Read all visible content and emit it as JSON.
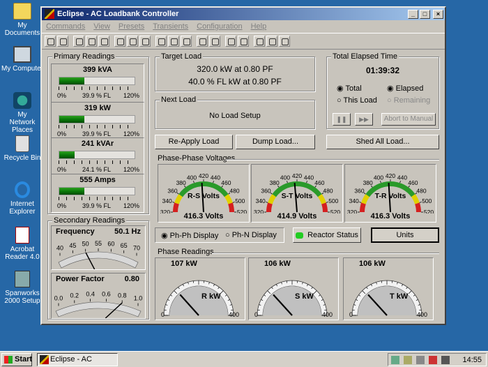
{
  "desktop": {
    "icons": [
      {
        "label": "My Documents"
      },
      {
        "label": "My Computer"
      },
      {
        "label": "My Network Places"
      },
      {
        "label": "Recycle Bin"
      },
      {
        "label": "Internet Explorer"
      },
      {
        "label": "Acrobat Reader 4.0"
      },
      {
        "label": "Spanworks 2000 Setup"
      }
    ]
  },
  "window": {
    "title": "Eclipse - AC Loadbank Controller",
    "controls": {
      "minimize": "_",
      "maximize": "□",
      "close": "×"
    }
  },
  "menu": [
    "Commands",
    "View",
    "Presets",
    "Transients",
    "Configuration",
    "Help"
  ],
  "primary": {
    "title": "Primary Readings",
    "readings": [
      {
        "value": "399 kVA",
        "pct": "39.9 % FL",
        "fill": 0.333,
        "lo": "0%",
        "hi": "120%"
      },
      {
        "value": "319 kW",
        "pct": "39.9 % FL",
        "fill": 0.333,
        "lo": "0%",
        "hi": "120%"
      },
      {
        "value": "241 kVAr",
        "pct": "24.1 % FL",
        "fill": 0.2,
        "lo": "0%",
        "hi": "120%"
      },
      {
        "value": "555 Amps",
        "pct": "39.9 % FL",
        "fill": 0.333,
        "lo": "0%",
        "hi": "120%"
      }
    ]
  },
  "secondary": {
    "title": "Secondary Readings",
    "frequency": {
      "label": "Frequency",
      "value": "50.1 Hz",
      "ticks": [
        "40",
        "45",
        "50",
        "55",
        "60",
        "65",
        "70"
      ],
      "reading": 50.1
    },
    "power_factor": {
      "label": "Power Factor",
      "value": "0.80",
      "ticks": [
        "0.0",
        "0.2",
        "0.4",
        "0.6",
        "0.8",
        "1.0"
      ],
      "reading": 0.8
    }
  },
  "target": {
    "title": "Target Load",
    "line1": "320.0 kW at 0.80 PF",
    "line2": "40.0 % FL kW at 0.80 PF"
  },
  "next": {
    "title": "Next Load",
    "text": "No Load Setup"
  },
  "elapsed": {
    "title": "Total Elapsed Time",
    "time": "01:39:32",
    "opt_total": "Total",
    "opt_this": "This Load",
    "opt_elapsed": "Elapsed",
    "opt_remaining": "Remaining",
    "abort": "Abort to Manual"
  },
  "buttons": {
    "reapply": "Re-Apply Load",
    "dump": "Dump Load...",
    "shed": "Shed All Load..."
  },
  "voltages": {
    "title": "Phase-Phase Voltages",
    "scale": [
      "320",
      "340",
      "360",
      "380",
      "400",
      "420",
      "440",
      "460",
      "480",
      "500",
      "520"
    ],
    "gauges": [
      {
        "label": "R-S Volts",
        "value": "416.3 Volts",
        "reading": 416.3
      },
      {
        "label": "S-T Volts",
        "value": "414.9 Volts",
        "reading": 414.9
      },
      {
        "label": "T-R Volts",
        "value": "416.3 Volts",
        "reading": 416.3
      }
    ]
  },
  "display": {
    "ph_ph": "Ph-Ph Display",
    "ph_n": "Ph-N Display",
    "reactor": "Reactor Status",
    "units": "Units"
  },
  "phase": {
    "title": "Phase Readings",
    "min": "0",
    "max": "400",
    "gauges": [
      {
        "value": "107 kW",
        "label": "R kW",
        "reading": 107
      },
      {
        "value": "106 kW",
        "label": "S kW",
        "reading": 106
      },
      {
        "value": "106 kW",
        "label": "T kW",
        "reading": 106
      }
    ]
  },
  "taskbar": {
    "start": "Start",
    "task": "Eclipse - AC Loadba...",
    "clock": "14:55"
  }
}
